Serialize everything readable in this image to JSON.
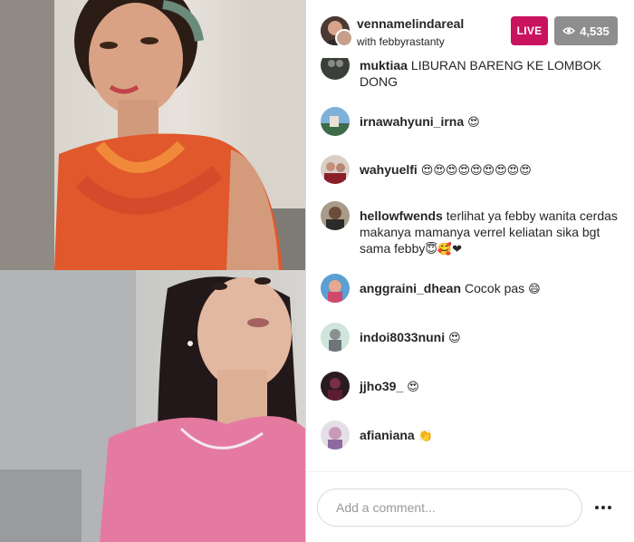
{
  "header": {
    "host_username": "vennamelindareal",
    "with_text": "with febbyrastanty",
    "live_label": "LIVE",
    "viewer_count": "4,535",
    "viewer_icon": "eye-icon"
  },
  "colors": {
    "live_badge": "#c9135f",
    "viewer_badge": "#8e8e8e"
  },
  "comments": [
    {
      "username": "muktiaa",
      "text": "LIBURAN BARENG KE LOMBOK DONG",
      "emoji": ""
    },
    {
      "username": "irnawahyuni_irna",
      "text": "",
      "emoji": "😍"
    },
    {
      "username": "wahyuelfi",
      "text": "",
      "emoji": "😍😍😍😍😍😍😍😍😍"
    },
    {
      "username": "hellowfwends",
      "text": "terlihat ya febby wanita cerdas makanya mamanya verrel keliatan sika bgt sama febby",
      "emoji": "😇🥰❤"
    },
    {
      "username": "anggraini_dhean",
      "text": "Cocok pas",
      "emoji": "😄"
    },
    {
      "username": "indoi8033nuni",
      "text": "",
      "emoji": "😍"
    },
    {
      "username": "jjho39_",
      "text": "",
      "emoji": "😍"
    },
    {
      "username": "afianiana",
      "text": "",
      "emoji": "👏"
    }
  ],
  "composer": {
    "placeholder": "Add a comment..."
  }
}
